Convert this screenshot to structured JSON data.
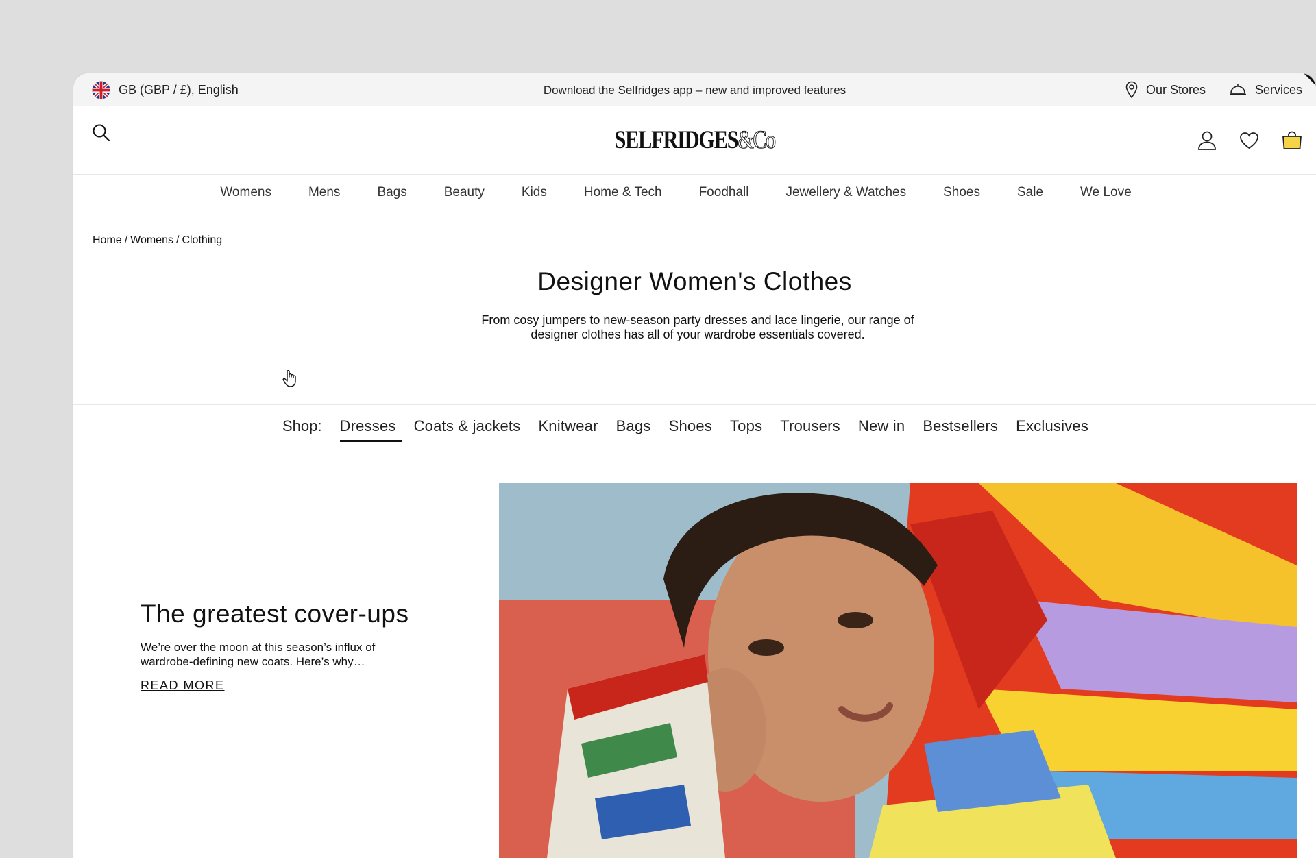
{
  "topbar": {
    "locale": "GB (GBP / £), English",
    "promo": "Download the Selfridges app – new and improved features",
    "stores": "Our Stores",
    "services": "Services"
  },
  "header": {
    "logo_main": "SELFRIDGES",
    "logo_co": "&Co",
    "search_placeholder": ""
  },
  "nav": [
    "Womens",
    "Mens",
    "Bags",
    "Beauty",
    "Kids",
    "Home & Tech",
    "Foodhall",
    "Jewellery & Watches",
    "Shoes",
    "Sale",
    "We Love"
  ],
  "breadcrumb": [
    "Home",
    "Womens",
    "Clothing"
  ],
  "page": {
    "title": "Designer Women's Clothes",
    "description": "From cosy jumpers to new-season party dresses and lace lingerie, our range of designer clothes has all of your wardrobe essentials covered."
  },
  "shop": {
    "label": "Shop:",
    "items": [
      "Dresses",
      "Coats & jackets",
      "Knitwear",
      "Bags",
      "Shoes",
      "Tops",
      "Trousers",
      "New in",
      "Bestsellers",
      "Exclusives"
    ],
    "active": "Dresses"
  },
  "editorial": {
    "title": "The greatest cover-ups",
    "text": "We’re over the moon at this season’s influx of wardrobe-defining new coats. Here’s why…",
    "cta": "READ MORE"
  },
  "icons": {
    "flag": "uk-flag-icon",
    "stores": "location-pin-icon",
    "services": "service-bell-icon",
    "search": "search-icon",
    "account": "account-icon",
    "wishlist": "heart-icon",
    "bag": "shopping-bag-icon"
  },
  "colors": {
    "background": "#dedede",
    "topbar": "#f4f4f4",
    "bag_yellow": "#f5d547"
  }
}
